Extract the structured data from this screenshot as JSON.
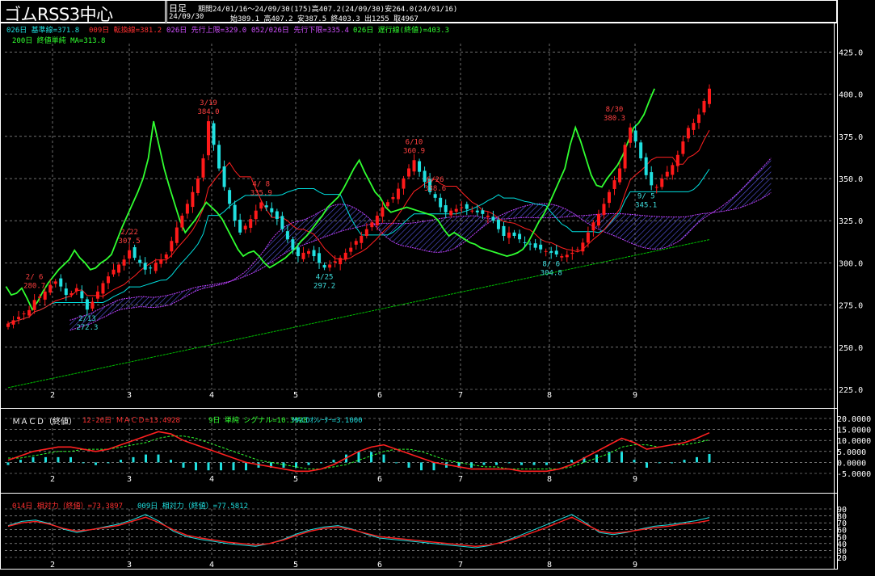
{
  "header": {
    "title": "ゴムRSS3中心",
    "timeframe": "日足",
    "period_line": "期間24/01/16～24/09/30(175)高407.2(24/09/30)安264.0(24/01/16)",
    "date": "24/09/30",
    "ohlc_line": "始389.1 高407.2 安387.5 終403.3 出1255 取4967"
  },
  "legend_main": {
    "kijun": "026日 基準線=371.8",
    "tenkan": "009日 転換線=381.2",
    "senkou_a": "026日 先行上限=329.0",
    "senkou_b": "052/026日 先行下限=335.4",
    "chikou": "026日 遅行線(終値)=403.3",
    "ma200": "200日 終値単純 MA=313.8"
  },
  "legend_macd": {
    "name": "ＭＡＣＤ（終値）",
    "macd": "12-26日 ＭＡＣＤ=13.4928",
    "signal": "9日 単純 シグナル=10.3328",
    "osc": "MACDｵｼﾚｰﾀｰ=3.1000"
  },
  "legend_rsi": {
    "rsi14": "014日 相対力（終値）=73.3897",
    "rsi9": "009日 相対力（終値）=77.5812"
  },
  "colors": {
    "bull": "#ff1a1a",
    "bear": "#20e0e0",
    "kijun": "#00e0e0",
    "tenkan": "#ff2020",
    "chikou": "#30ff30",
    "ma200": "#00c000",
    "cloud": "#c040ff",
    "grid": "#ffffff"
  },
  "chart_data": [
    {
      "type": "candlestick",
      "name": "price",
      "x_tick_labels": [
        "2",
        "3",
        "4",
        "5",
        "6",
        "7",
        "8",
        "9"
      ],
      "y_tick_labels": [
        "425.0",
        "400.0",
        "375.0",
        "350.0",
        "325.0",
        "300.0",
        "275.0",
        "250.0",
        "225.0"
      ],
      "ylim": [
        225,
        430
      ],
      "closes": [
        264,
        266,
        268,
        270,
        272,
        278,
        280,
        283,
        287,
        289,
        286,
        281,
        282,
        285,
        279,
        272.3,
        277,
        283,
        288,
        292,
        296,
        299,
        302,
        307.5,
        303,
        300,
        296,
        297,
        300,
        302,
        305,
        313,
        321,
        328,
        335,
        342,
        350,
        362,
        384.0,
        370,
        356,
        345,
        335,
        325,
        318,
        322,
        326,
        331,
        335.9,
        333,
        330,
        326,
        320,
        314,
        308,
        304,
        306,
        307,
        304,
        300,
        297.2,
        299,
        301,
        303,
        306,
        309,
        313,
        316,
        320,
        324,
        328,
        333,
        336,
        339,
        344,
        350,
        356,
        360.9,
        354,
        348,
        342,
        338.6,
        333,
        330,
        331,
        332,
        333,
        332,
        331,
        330,
        329,
        328,
        325,
        320,
        316,
        318,
        316,
        314,
        312,
        311,
        309,
        308,
        307,
        306,
        305,
        304,
        304.8,
        306,
        308,
        312,
        318,
        324,
        329,
        335,
        342,
        349,
        356,
        370,
        380.3,
        372,
        362,
        352,
        346,
        345,
        350,
        354,
        358,
        364,
        372,
        380,
        383,
        388,
        396,
        403.3
      ],
      "annotations": [
        {
          "label": "2/ 6",
          "value": "280.7"
        },
        {
          "label": "2/13",
          "value": "272.3"
        },
        {
          "label": "2/22",
          "value": "307.5"
        },
        {
          "label": "3/19",
          "value": "384.0"
        },
        {
          "label": "4/ 8",
          "value": "335.9"
        },
        {
          "label": "4/25",
          "value": "297.2"
        },
        {
          "label": "6/10",
          "value": "360.9"
        },
        {
          "label": "6/26",
          "value": "338.6"
        },
        {
          "label": "8/ 6",
          "value": "304.8"
        },
        {
          "label": "8/30",
          "value": "380.3"
        },
        {
          "label": "9/ 5",
          "value": "345.1"
        }
      ]
    },
    {
      "type": "line",
      "name": "macd",
      "y_tick_labels": [
        "20.0000",
        "15.0000",
        "10.0000",
        "5.0000",
        "0.0000",
        "-5.0000"
      ],
      "ylim": [
        -5,
        20
      ],
      "series": [
        {
          "name": "ＭＡＣＤ",
          "values": [
            1,
            3,
            5,
            6,
            7,
            7,
            6,
            5,
            6,
            8,
            10,
            12,
            14,
            13,
            10,
            8,
            6,
            4,
            2,
            0,
            -1,
            -2,
            -3,
            -4,
            -4,
            -3,
            -1,
            2,
            5,
            7,
            8,
            6,
            4,
            2,
            0,
            -1,
            -2,
            -3,
            -3,
            -3,
            -3,
            -4,
            -4,
            -4,
            -3,
            -1,
            2,
            5,
            8,
            11,
            9,
            6,
            7,
            8,
            9,
            11,
            13.5
          ]
        },
        {
          "name": "シグナル",
          "values": [
            2,
            2,
            3,
            4,
            5,
            5,
            6,
            6,
            6,
            7,
            8,
            9,
            11,
            12,
            12,
            11,
            9,
            7,
            5,
            3,
            1,
            0,
            -1,
            -2,
            -3,
            -3,
            -2,
            -1,
            1,
            3,
            5,
            6,
            6,
            5,
            3,
            1,
            0,
            -1,
            -2,
            -2,
            -3,
            -3,
            -3,
            -3,
            -3,
            -2,
            0,
            2,
            4,
            7,
            8,
            8,
            7,
            8,
            8,
            9,
            10.3
          ]
        }
      ]
    },
    {
      "type": "line",
      "name": "rsi",
      "y_tick_labels": [
        "90",
        "80",
        "70",
        "60",
        "50",
        "40",
        "30",
        "20"
      ],
      "ylim": [
        20,
        90
      ],
      "series": [
        {
          "name": "相対力14",
          "values": [
            65,
            70,
            72,
            68,
            62,
            58,
            60,
            63,
            66,
            72,
            78,
            70,
            60,
            52,
            48,
            45,
            42,
            40,
            38,
            40,
            45,
            52,
            58,
            62,
            64,
            60,
            55,
            50,
            48,
            46,
            44,
            42,
            40,
            38,
            36,
            38,
            42,
            48,
            55,
            62,
            70,
            78,
            68,
            58,
            55,
            57,
            60,
            63,
            65,
            68,
            70,
            73.4
          ]
        },
        {
          "name": "相対力9",
          "values": [
            66,
            72,
            74,
            69,
            61,
            56,
            60,
            64,
            68,
            74,
            82,
            72,
            58,
            50,
            46,
            43,
            40,
            38,
            36,
            40,
            46,
            54,
            60,
            64,
            66,
            61,
            54,
            48,
            46,
            44,
            42,
            40,
            38,
            36,
            34,
            37,
            43,
            50,
            58,
            66,
            74,
            82,
            70,
            56,
            53,
            56,
            61,
            65,
            67,
            70,
            73,
            77.6
          ]
        }
      ]
    }
  ]
}
